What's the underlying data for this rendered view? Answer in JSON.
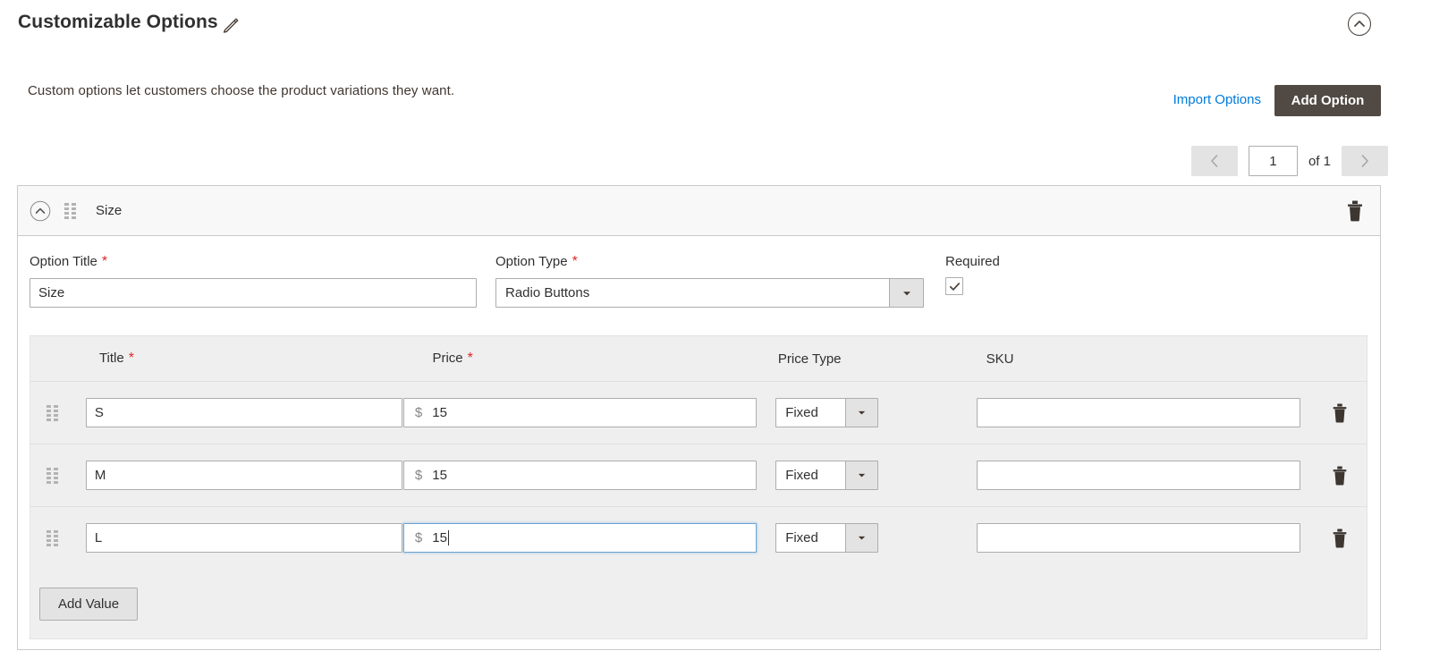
{
  "section": {
    "title": "Customizable Options",
    "edit_icon": "pencil-icon",
    "collapse_icon": "chevron-up-circle-icon",
    "description": "Custom options let customers choose the product variations they want."
  },
  "actions": {
    "import_label": "Import Options",
    "add_option_label": "Add Option"
  },
  "pagination": {
    "prev_icon": "chevron-left-icon",
    "next_icon": "chevron-right-icon",
    "current_page": "1",
    "of_label": "of 1"
  },
  "option": {
    "collapse_icon": "chevron-up-circle-icon",
    "drag_icon": "drag-handle-icon",
    "header_title": "Size",
    "delete_icon": "trash-icon",
    "fields": {
      "title_label": "Option Title",
      "title_required_mark": "*",
      "title_value": "Size",
      "type_label": "Option Type",
      "type_required_mark": "*",
      "type_value": "Radio Buttons",
      "type_arrow_icon": "chevron-down-icon",
      "required_label": "Required",
      "required_checked": true,
      "required_check_icon": "check-icon"
    },
    "values_table": {
      "columns": [
        "Title",
        "Price",
        "Price Type",
        "SKU"
      ],
      "title_required_mark": "*",
      "price_required_mark": "*",
      "currency_symbol": "$",
      "rows": [
        {
          "handle_icon": "drag-handle-icon",
          "title": "S",
          "price": "15",
          "price_type": "Fixed",
          "sku": "",
          "delete_icon": "trash-icon",
          "focused": false
        },
        {
          "handle_icon": "drag-handle-icon",
          "title": "M",
          "price": "15",
          "price_type": "Fixed",
          "sku": "",
          "delete_icon": "trash-icon",
          "focused": false
        },
        {
          "handle_icon": "drag-handle-icon",
          "title": "L",
          "price": "15",
          "price_type": "Fixed",
          "sku": "",
          "delete_icon": "trash-icon",
          "focused": true
        }
      ],
      "add_value_label": "Add Value"
    }
  },
  "colors": {
    "accent_link": "#007bdb",
    "primary_button": "#514943",
    "required_star": "#e22626",
    "table_bg": "#efefef",
    "focus_border": "#6ca4d4"
  }
}
